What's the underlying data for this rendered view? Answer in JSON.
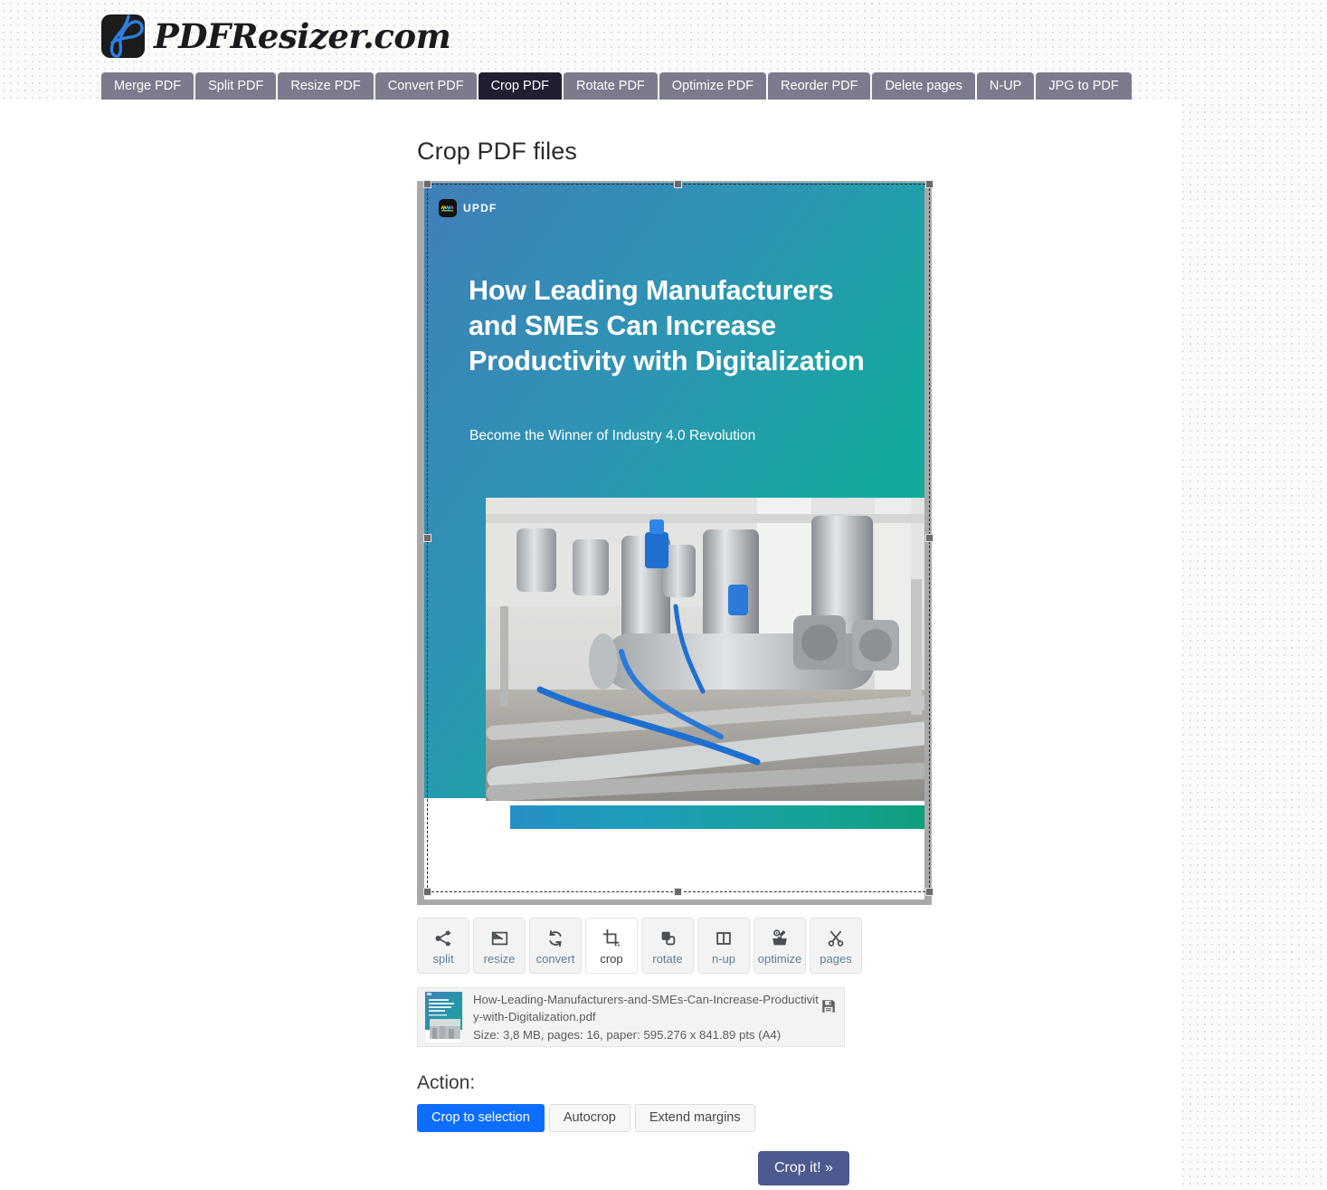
{
  "site": {
    "logo_text": "PDFResizer.com",
    "logo_icon": "pdf-document-icon"
  },
  "tabs": [
    {
      "label": "Merge PDF",
      "active": false
    },
    {
      "label": "Split PDF",
      "active": false
    },
    {
      "label": "Resize PDF",
      "active": false
    },
    {
      "label": "Convert PDF",
      "active": false
    },
    {
      "label": "Crop PDF",
      "active": true
    },
    {
      "label": "Rotate PDF",
      "active": false
    },
    {
      "label": "Optimize PDF",
      "active": false
    },
    {
      "label": "Reorder PDF",
      "active": false
    },
    {
      "label": "Delete pages",
      "active": false
    },
    {
      "label": "N-UP",
      "active": false
    },
    {
      "label": "JPG to PDF",
      "active": false
    }
  ],
  "page": {
    "title": "Crop PDF files"
  },
  "preview": {
    "brand_mark": "UPDF",
    "doc_title": "How Leading Manufacturers and SMEs Can Increase Productivity with Digitalization",
    "doc_subtitle": "Become the Winner of Industry 4.0 Revolution",
    "photo_alt": "industrial-pipes-machinery-photo",
    "selection_border_style": "dashed",
    "handle_color": "#6a6a6a",
    "gradient_from": "#3f7fb8",
    "gradient_to": "#0fab93"
  },
  "toolbar": [
    {
      "label": "split",
      "icon": "share-nodes-icon",
      "active": false
    },
    {
      "label": "resize",
      "icon": "resize-frame-icon",
      "active": false
    },
    {
      "label": "convert",
      "icon": "refresh-cycle-icon",
      "active": false
    },
    {
      "label": "crop",
      "icon": "crop-icon",
      "active": true
    },
    {
      "label": "rotate",
      "icon": "rotate-shapes-icon",
      "active": false
    },
    {
      "label": "n-up",
      "icon": "columns-icon",
      "active": false
    },
    {
      "label": "optimize",
      "icon": "toolbox-gear-icon",
      "active": false
    },
    {
      "label": "pages",
      "icon": "scissors-icon",
      "active": false
    }
  ],
  "file": {
    "name": "How-Leading-Manufacturers-and-SMEs-Can-Increase-Productivity-with-Digitalization.pdf",
    "details": "Size: 3,8 MB, pages: 16, paper: 595.276 x 841.89 pts (A4)",
    "save_icon": "floppy-disk-icon",
    "thumbnail_alt": "pdf-cover-thumbnail"
  },
  "action": {
    "label": "Action:",
    "options": [
      {
        "label": "Crop to selection",
        "selected": true
      },
      {
        "label": "Autocrop",
        "selected": false
      },
      {
        "label": "Extend margins",
        "selected": false
      }
    ],
    "submit_label": "Crop it! »",
    "accent_color": "#0d6efd",
    "submit_color": "#4c5a90"
  }
}
